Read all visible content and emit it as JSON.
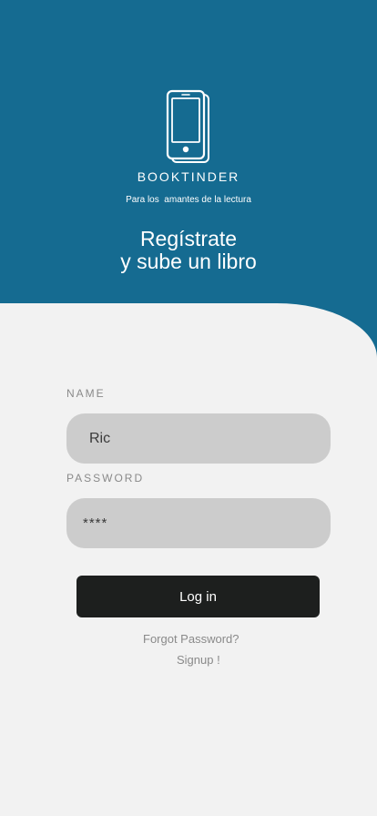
{
  "brand": {
    "logo_icon": "phone-book-icon",
    "name": "BOOKTINDER",
    "tagline": "Para los  amantes de la lectura"
  },
  "headline": {
    "line1": "Regístrate",
    "line2": "y sube un libro"
  },
  "form": {
    "name_label": "NAME",
    "name_value": "Ric",
    "password_label": "PASSWORD",
    "password_value": "****",
    "login_label": "Log in",
    "forgot_label": "Forgot Password?",
    "signup_label": "Signup !"
  },
  "colors": {
    "header_bg": "#156b91",
    "page_bg": "#f2f2f2",
    "input_bg": "#cccccc",
    "button_bg": "#1d1f1e",
    "muted_text": "#8a8a8a"
  }
}
